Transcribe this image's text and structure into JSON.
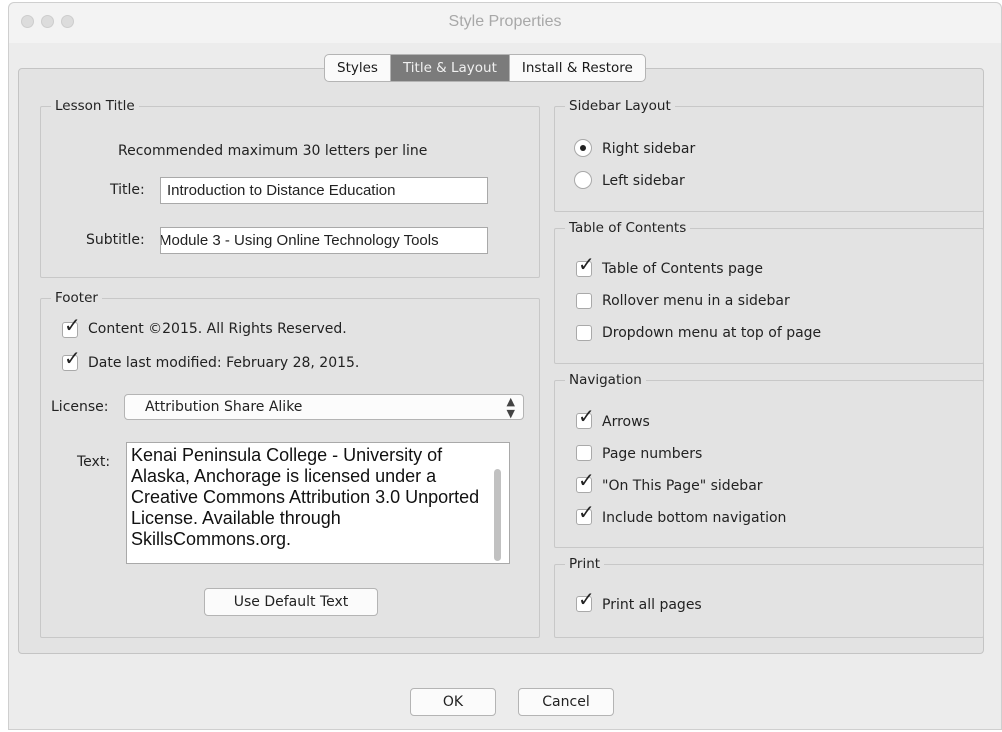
{
  "window": {
    "title": "Style Properties"
  },
  "tabs": [
    {
      "label": "Styles",
      "active": false
    },
    {
      "label": "Title & Layout",
      "active": true
    },
    {
      "label": "Install & Restore",
      "active": false
    }
  ],
  "lesson_title": {
    "group_label": "Lesson Title",
    "hint": "Recommended maximum 30 letters per line",
    "title_label": "Title:",
    "title_value": "Introduction to Distance Education",
    "subtitle_label": "Subtitle:",
    "subtitle_value": "Module 3 - Using Online Technology Tools"
  },
  "footer": {
    "group_label": "Footer",
    "content_check": {
      "label": "Content ©2015. All Rights Reserved.",
      "checked": true
    },
    "date_check": {
      "label": "Date last modified: February 28, 2015.",
      "checked": true
    },
    "license_label": "License:",
    "license_value": "Attribution Share Alike",
    "text_label": "Text:",
    "text_value": "Kenai Peninsula College - University of Alaska, Anchorage is licensed under a Creative Commons Attribution 3.0 Unported License. Available through SkillsCommons.org.",
    "default_button": "Use Default Text"
  },
  "sidebar_layout": {
    "group_label": "Sidebar Layout",
    "options": [
      {
        "label": "Right sidebar",
        "selected": true
      },
      {
        "label": "Left sidebar",
        "selected": false
      }
    ]
  },
  "toc": {
    "group_label": "Table of Contents",
    "items": [
      {
        "label": "Table of Contents page",
        "checked": true
      },
      {
        "label": "Rollover menu in a sidebar",
        "checked": false
      },
      {
        "label": "Dropdown menu at top of page",
        "checked": false
      }
    ]
  },
  "navigation": {
    "group_label": "Navigation",
    "items": [
      {
        "label": "Arrows",
        "checked": true
      },
      {
        "label": "Page numbers",
        "checked": false
      },
      {
        "label": "\"On This Page\" sidebar",
        "checked": true
      },
      {
        "label": "Include bottom navigation",
        "checked": true
      }
    ]
  },
  "print": {
    "group_label": "Print",
    "items": [
      {
        "label": "Print all pages",
        "checked": true
      }
    ]
  },
  "buttons": {
    "ok": "OK",
    "cancel": "Cancel"
  },
  "check_glyph": "✓"
}
